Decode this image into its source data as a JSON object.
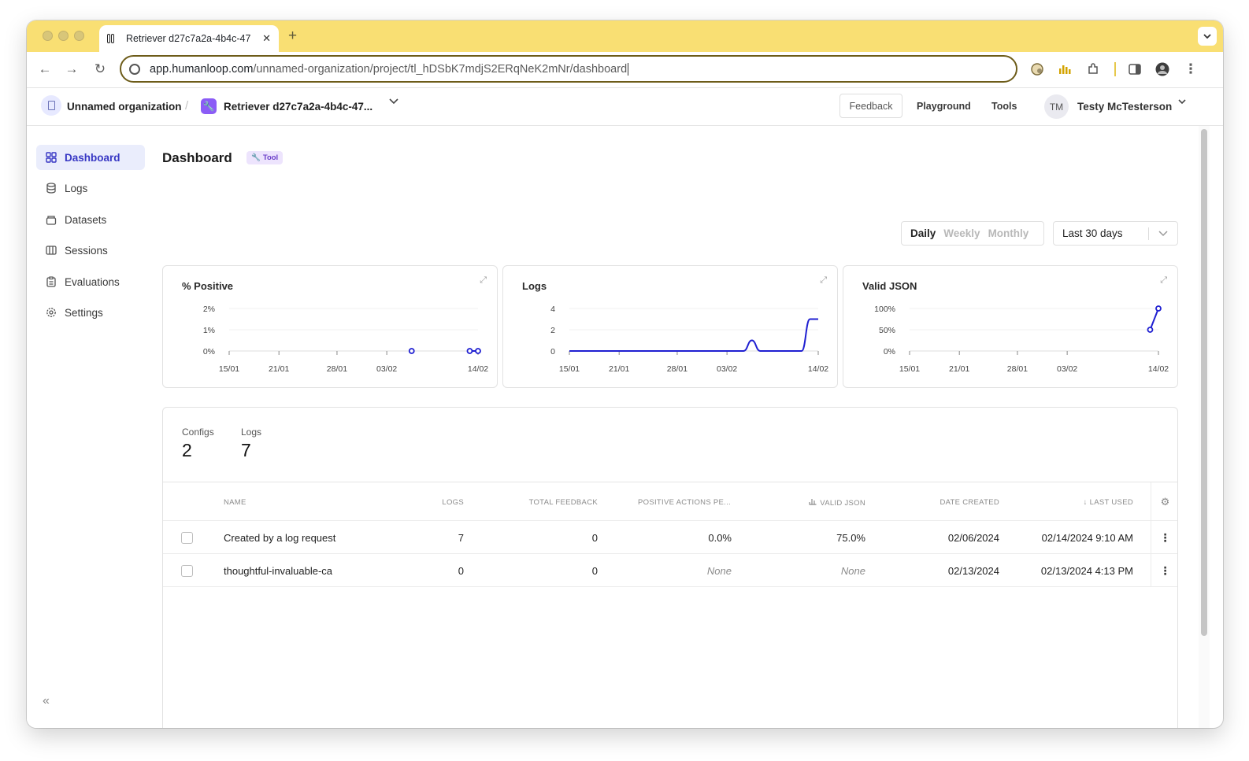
{
  "browser": {
    "tab_title": "Retriever d27c7a2a-4b4c-47",
    "tab_close": "✕",
    "new_tab": "+",
    "url_host": "app.humanloop.com",
    "url_path": "/unnamed-organization/project/tl_hDSbK7mdjS2ERqNeK2mNr/dashboard"
  },
  "header": {
    "org_name": "Unnamed organization",
    "separator": "/",
    "project_name": "Retriever d27c7a2a-4b4c-47...",
    "feedback_label": "Feedback",
    "playground_label": "Playground",
    "tools_label": "Tools",
    "user_initials": "TM",
    "user_name": "Testy McTesterson"
  },
  "sidebar": {
    "items": [
      {
        "label": "Dashboard",
        "icon": "grid-icon"
      },
      {
        "label": "Logs",
        "icon": "database-icon"
      },
      {
        "label": "Datasets",
        "icon": "stack-icon"
      },
      {
        "label": "Sessions",
        "icon": "columns-icon"
      },
      {
        "label": "Evaluations",
        "icon": "clipboard-icon"
      },
      {
        "label": "Settings",
        "icon": "gear-icon"
      }
    ],
    "collapse_icon": "«"
  },
  "main": {
    "title": "Dashboard",
    "badge": "Tool",
    "granularity": [
      "Daily",
      "Weekly",
      "Monthly"
    ],
    "selected_granularity": "Daily",
    "range_label": "Last 30 days"
  },
  "chart_data": [
    {
      "type": "scatter",
      "title": "% Positive",
      "x_ticks": [
        "15/01",
        "21/01",
        "28/01",
        "03/02",
        "14/02"
      ],
      "y_ticks": [
        "2%",
        "1%",
        "0%"
      ],
      "ylim": [
        0,
        2
      ],
      "points": [
        {
          "x": "06/02",
          "y": 0
        },
        {
          "x": "13/02",
          "y": 0
        },
        {
          "x": "14/02",
          "y": 0
        }
      ],
      "grid": true
    },
    {
      "type": "line",
      "title": "Logs",
      "x_ticks": [
        "15/01",
        "21/01",
        "28/01",
        "03/02",
        "14/02"
      ],
      "y_ticks": [
        "4",
        "2",
        "0"
      ],
      "ylim": [
        0,
        4
      ],
      "series": [
        {
          "values": [
            0,
            0,
            0,
            0,
            0,
            0,
            0,
            0,
            0,
            0,
            0,
            0,
            0,
            0,
            0,
            0,
            0,
            0,
            0,
            0,
            0,
            0,
            1,
            0,
            0,
            0,
            0,
            0,
            0,
            3,
            3
          ]
        }
      ],
      "x_start": "15/01",
      "grid": true
    },
    {
      "type": "line",
      "title": "Valid JSON",
      "x_ticks": [
        "15/01",
        "21/01",
        "28/01",
        "03/02",
        "14/02"
      ],
      "y_ticks": [
        "100%",
        "50%",
        "0%"
      ],
      "ylim": [
        0,
        100
      ],
      "points": [
        {
          "x": "13/02",
          "y": 50
        },
        {
          "x": "14/02",
          "y": 100
        }
      ],
      "grid": true
    }
  ],
  "stats": [
    {
      "label": "Configs",
      "value": "2"
    },
    {
      "label": "Logs",
      "value": "7"
    }
  ],
  "table": {
    "columns": [
      "NAME",
      "LOGS",
      "TOTAL FEEDBACK",
      "POSITIVE ACTIONS PE...",
      "VALID JSON",
      "DATE CREATED",
      "LAST USED"
    ],
    "rows": [
      {
        "name": "Created by a log request",
        "logs": "7",
        "feedback": "0",
        "positive": "0.0%",
        "valid_json": "75.0%",
        "created": "02/06/2024",
        "last_used": "02/14/2024 9:10 AM"
      },
      {
        "name": "thoughtful-invaluable-ca",
        "logs": "0",
        "feedback": "0",
        "positive": "None",
        "valid_json": "None",
        "created": "02/13/2024",
        "last_used": "02/13/2024 4:13 PM"
      }
    ]
  },
  "colors": {
    "accent": "#1f1fd1",
    "tab_strip": "#f9df73",
    "active_nav_bg": "#eaedfc",
    "badge_bg": "#ede4fd"
  }
}
